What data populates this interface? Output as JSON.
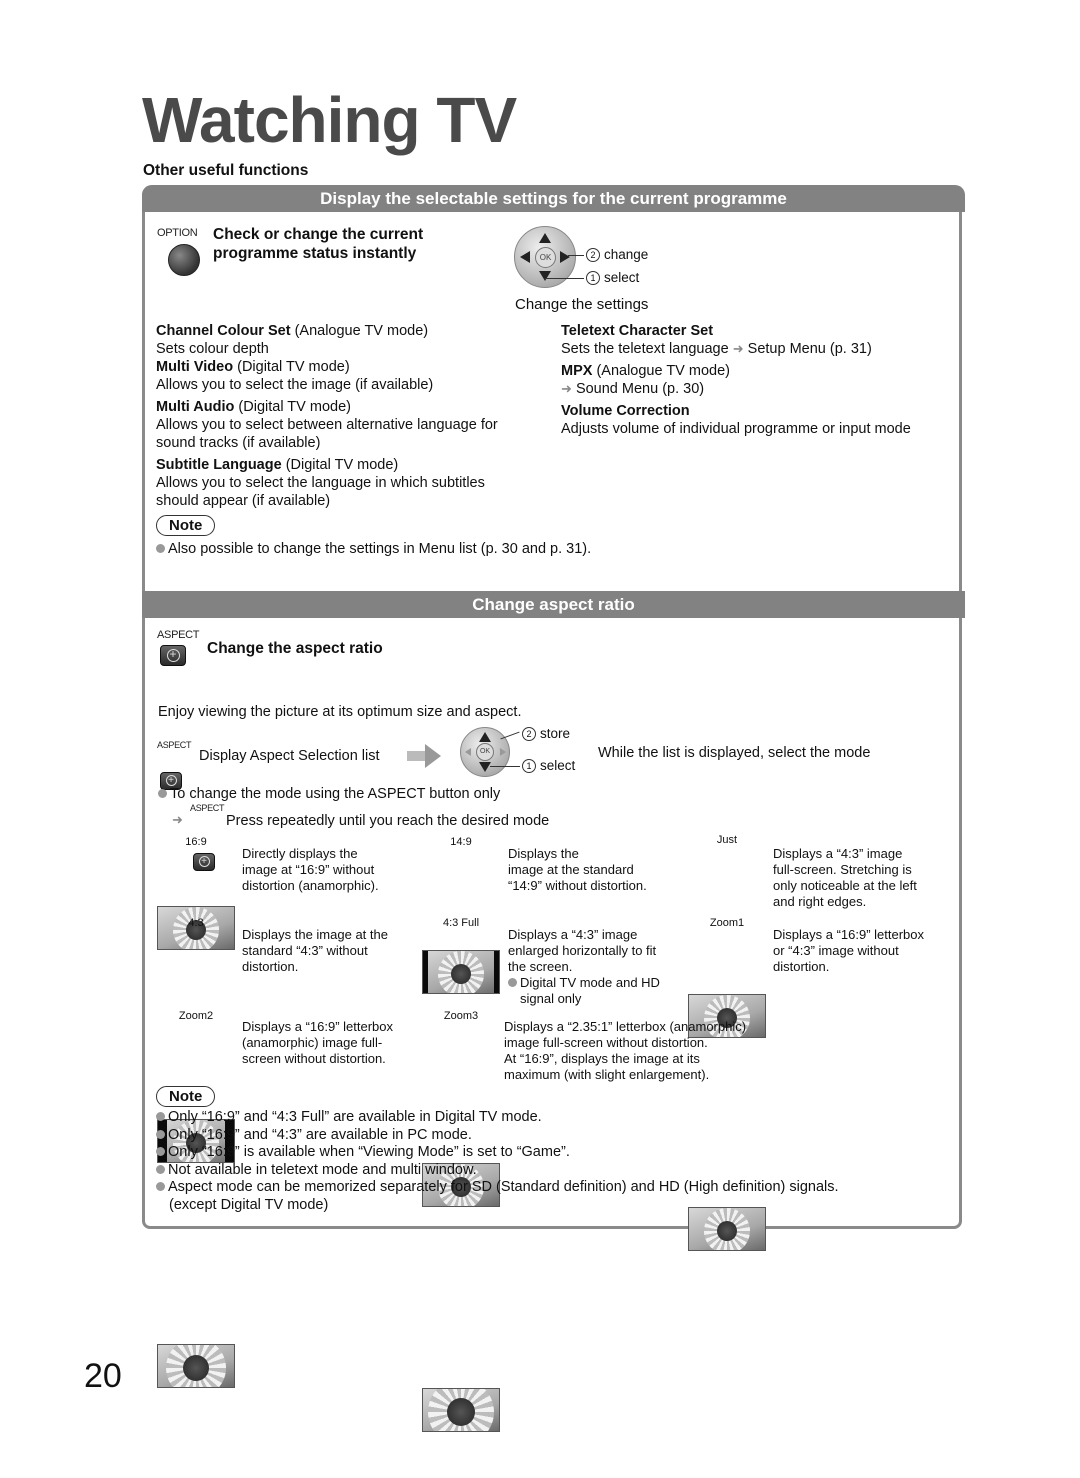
{
  "page": {
    "title": "Watching TV",
    "section_label": "Other useful functions",
    "page_number": "20"
  },
  "display_settings": {
    "header": "Display the selectable settings for the current programme",
    "button_caption": "OPTION",
    "instruction_line1": "Check or change the current",
    "instruction_line2": "programme status instantly",
    "dpad": {
      "ok": "OK",
      "step2_num": "2",
      "step2": "change",
      "step1_num": "1",
      "step1": "select",
      "caption": "Change the settings"
    },
    "left_items": [
      {
        "name": "Channel Colour Set",
        "mode": "(Analogue TV mode)",
        "desc": [
          "Sets colour depth"
        ]
      },
      {
        "name": "Multi Video",
        "mode": "(Digital TV mode)",
        "desc": [
          "Allows you to select the image (if available)"
        ]
      },
      {
        "name": "Multi Audio",
        "mode": "(Digital TV mode)",
        "desc": [
          "Allows you to select between alternative language for",
          "sound tracks (if available)"
        ]
      },
      {
        "name": "Subtitle Language",
        "mode": "(Digital TV mode)",
        "desc": [
          "Allows you to select the language in which subtitles",
          "should appear (if available)"
        ]
      }
    ],
    "right_items": [
      {
        "name": "Teletext Character Set",
        "mode": "",
        "desc_prefix": "Sets the teletext language",
        "desc_link": "Setup Menu (p. 31)"
      },
      {
        "name": "MPX",
        "mode": "(Analogue TV mode)",
        "desc_prefix": "",
        "desc_link": "Sound Menu (p. 30)"
      },
      {
        "name": "Volume Correction",
        "mode": "",
        "desc": "Adjusts volume of individual programme or input mode"
      }
    ],
    "note_label": "Note",
    "note": "Also possible to change the settings in Menu list (p. 30 and p. 31)."
  },
  "aspect": {
    "header": "Change aspect ratio",
    "button_caption": "ASPECT",
    "title": "Change the aspect ratio",
    "intro": "Enjoy viewing the picture at its optimum size and aspect.",
    "step_caption": "ASPECT",
    "step_text": "Display Aspect Selection list",
    "dpad": {
      "ok": "OK",
      "step2_num": "2",
      "step2": "store",
      "step1_num": "1",
      "step1": "select"
    },
    "while_text": "While the list is displayed, select the mode",
    "bullet_text": "To change the mode using the ASPECT button only",
    "press_caption": "ASPECT",
    "press_text": "Press repeatedly until you reach the desired mode",
    "modes": [
      {
        "label": "16:9",
        "desc": [
          "Directly displays the",
          "image at “16:9” without",
          "distortion (anamorphic)."
        ]
      },
      {
        "label": "14:9",
        "desc": [
          "Displays the",
          "image at the standard",
          "“14:9” without distortion."
        ]
      },
      {
        "label": "Just",
        "desc": [
          "Displays a “4:3” image",
          "full-screen. Stretching is",
          "only noticeable at the left",
          "and right edges."
        ]
      },
      {
        "label": "4:3",
        "desc": [
          "Displays the image at the",
          "standard “4:3” without",
          "distortion."
        ]
      },
      {
        "label": "4:3 Full",
        "desc": [
          "Displays a “4:3” image",
          "enlarged horizontally to fit",
          "the screen."
        ],
        "bullet": [
          "Digital TV mode and HD",
          "signal only"
        ]
      },
      {
        "label": "Zoom1",
        "desc": [
          "Displays a “16:9” letterbox",
          "or “4:3” image without",
          "distortion."
        ]
      },
      {
        "label": "Zoom2",
        "desc": [
          "Displays a “16:9” letterbox",
          "(anamorphic) image full-",
          "screen without distortion."
        ]
      },
      {
        "label": "Zoom3",
        "desc": [
          "Displays a “2.35:1” letterbox (anamorphic)",
          "image full-screen without distortion.",
          "At “16:9”, displays the image at its",
          "maximum (with slight enlargement)."
        ]
      }
    ],
    "note_label": "Note",
    "notes": [
      "Only “16:9” and “4:3 Full” are available in Digital TV mode.",
      "Only “16:9” and “4:3” are available in PC mode.",
      "Only “16:9” is available when “Viewing Mode” is set to “Game”.",
      "Not available in teletext mode and multi window.",
      "Aspect mode can be memorized separately for SD (Standard definition) and HD (High definition) signals.",
      "(except Digital TV mode)"
    ]
  }
}
